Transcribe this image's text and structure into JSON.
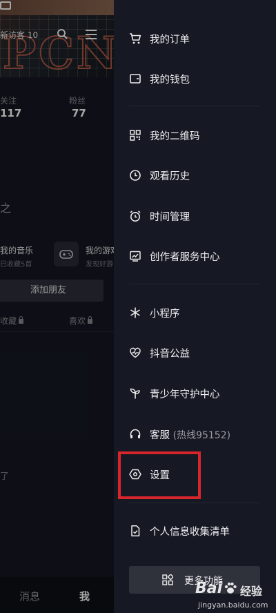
{
  "profile": {
    "visitors": "新访客 10",
    "stats": [
      {
        "label": "关注",
        "value": "117"
      },
      {
        "label": "粉丝",
        "value": "77"
      }
    ],
    "section_char": "之",
    "music": {
      "title": "我的音乐",
      "sub": "已收藏5首"
    },
    "game": {
      "title": "我的游戏",
      "sub": "发现好游"
    },
    "add_friend": "添加朋友",
    "tabs": [
      {
        "label": "收藏"
      },
      {
        "label": "喜欢"
      }
    ],
    "empty_hint": "了"
  },
  "bottom_nav": {
    "messages": "消息",
    "me": "我"
  },
  "drawer": {
    "items": [
      {
        "id": "orders",
        "label": "我的订单",
        "icon": "cart-icon"
      },
      {
        "id": "wallet",
        "label": "我的钱包",
        "icon": "wallet-icon"
      },
      {
        "id": "qrcode",
        "label": "我的二维码",
        "icon": "qrcode-icon"
      },
      {
        "id": "history",
        "label": "观看历史",
        "icon": "clock-icon"
      },
      {
        "id": "time",
        "label": "时间管理",
        "icon": "alarm-icon"
      },
      {
        "id": "creator",
        "label": "创作者服务中心",
        "icon": "chart-icon"
      },
      {
        "id": "miniapp",
        "label": "小程序",
        "icon": "asterisk-icon"
      },
      {
        "id": "charity",
        "label": "抖音公益",
        "icon": "heart-pulse-icon"
      },
      {
        "id": "youth",
        "label": "青少年守护中心",
        "icon": "sprout-icon"
      },
      {
        "id": "service",
        "label": "客服",
        "sub": "(热线95152)",
        "icon": "headset-icon"
      },
      {
        "id": "settings",
        "label": "设置",
        "icon": "hexagon-gear-icon"
      },
      {
        "id": "privacy",
        "label": "个人信息收集清单",
        "icon": "document-icon"
      }
    ],
    "more_button": "更多功能"
  },
  "watermark": {
    "logo": "Bai",
    "text": "经验",
    "url": "jingyan.baidu.com"
  },
  "colors": {
    "background": "#161823",
    "highlight": "#d7262b",
    "button": "#2f313b"
  }
}
